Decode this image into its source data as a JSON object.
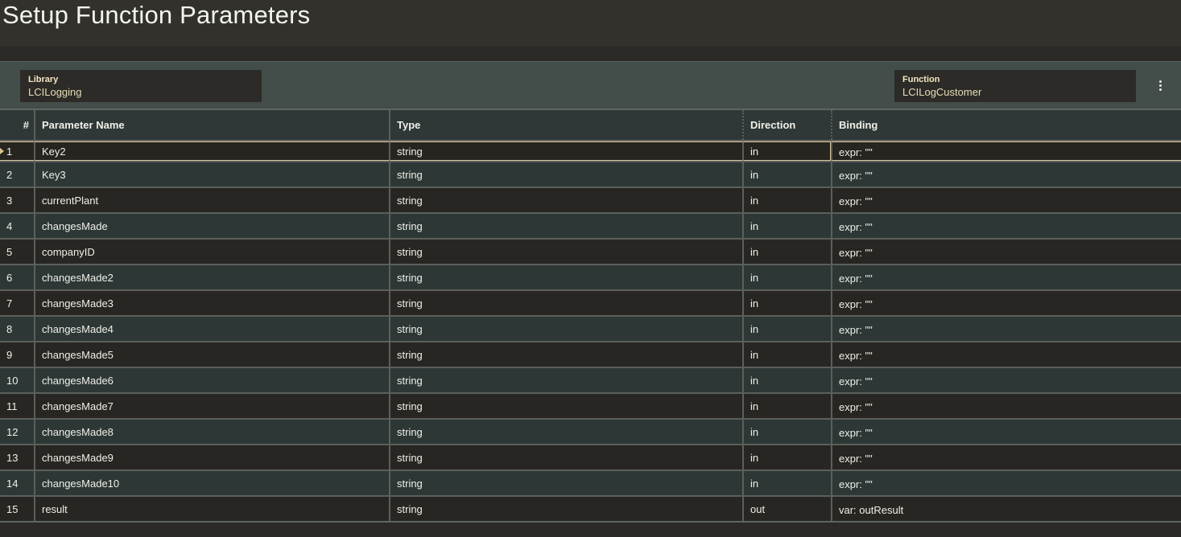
{
  "title": "Setup Function Parameters",
  "library": {
    "label": "Library",
    "value": "LCILogging"
  },
  "function": {
    "label": "Function",
    "value": "LCILogCustomer"
  },
  "menu_icon": "kebab-menu-icon",
  "table": {
    "headers": [
      "#",
      "Parameter Name",
      "Type",
      "Direction",
      "Binding"
    ],
    "rows": [
      {
        "num": "1",
        "name": "Key2",
        "type": "string",
        "direction": "in",
        "binding": "expr: \"\""
      },
      {
        "num": "2",
        "name": "Key3",
        "type": "string",
        "direction": "in",
        "binding": "expr: \"\""
      },
      {
        "num": "3",
        "name": "currentPlant",
        "type": "string",
        "direction": "in",
        "binding": "expr: \"\""
      },
      {
        "num": "4",
        "name": "changesMade",
        "type": "string",
        "direction": "in",
        "binding": "expr: \"\""
      },
      {
        "num": "5",
        "name": "companyID",
        "type": "string",
        "direction": "in",
        "binding": "expr: \"\""
      },
      {
        "num": "6",
        "name": "changesMade2",
        "type": "string",
        "direction": "in",
        "binding": "expr: \"\""
      },
      {
        "num": "7",
        "name": "changesMade3",
        "type": "string",
        "direction": "in",
        "binding": "expr: \"\""
      },
      {
        "num": "8",
        "name": "changesMade4",
        "type": "string",
        "direction": "in",
        "binding": "expr: \"\""
      },
      {
        "num": "9",
        "name": "changesMade5",
        "type": "string",
        "direction": "in",
        "binding": "expr: \"\""
      },
      {
        "num": "10",
        "name": "changesMade6",
        "type": "string",
        "direction": "in",
        "binding": "expr: \"\""
      },
      {
        "num": "11",
        "name": "changesMade7",
        "type": "string",
        "direction": "in",
        "binding": "expr: \"\""
      },
      {
        "num": "12",
        "name": "changesMade8",
        "type": "string",
        "direction": "in",
        "binding": "expr: \"\""
      },
      {
        "num": "13",
        "name": "changesMade9",
        "type": "string",
        "direction": "in",
        "binding": "expr: \"\""
      },
      {
        "num": "14",
        "name": "changesMade10",
        "type": "string",
        "direction": "in",
        "binding": "expr: \"\""
      },
      {
        "num": "15",
        "name": "result",
        "type": "string",
        "direction": "out",
        "binding": "var: outResult"
      }
    ]
  }
}
